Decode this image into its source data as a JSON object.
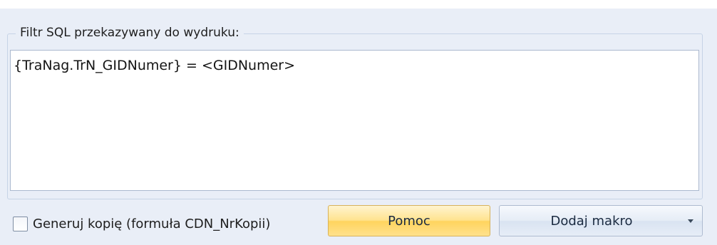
{
  "filter_group": {
    "legend": "Filtr SQL przekazywany do wydruku:",
    "sql_value": "{TraNag.TrN_GIDNumer} = <GIDNumer>"
  },
  "copy_checkbox": {
    "label": "Generuj kopię (formuła CDN_NrKopii)",
    "checked": false
  },
  "buttons": {
    "help_label": "Pomoc",
    "add_macro_label": "Dodaj makro"
  },
  "icons": {
    "dropdown": "chevron-down-icon"
  },
  "colors": {
    "panel_background": "#e9eef7",
    "help_button_accent": "#ffe38f",
    "macro_button_accent": "#dfe7f3"
  }
}
